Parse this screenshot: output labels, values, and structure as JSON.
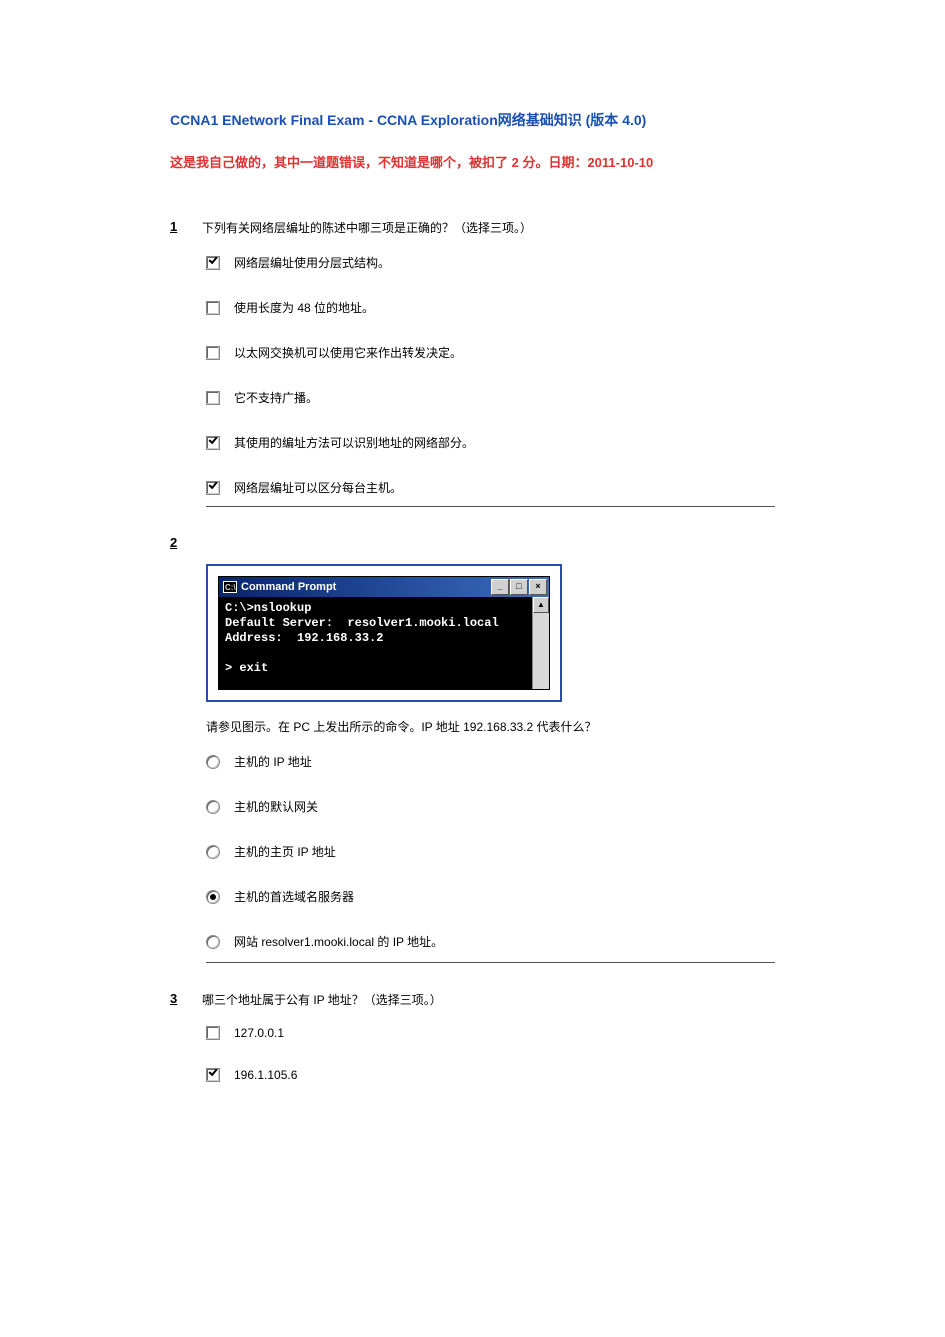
{
  "header": {
    "title": "CCNA1 ENetwork Final Exam - CCNA Exploration网络基础知识 (版本 4.0)",
    "subtitle": "这是我自己做的，其中一道题错误，不知道是哪个，被扣了 2 分。日期：2011-10-10"
  },
  "q1": {
    "num": "1",
    "text": "下列有关网络层编址的陈述中哪三项是正确的？（选择三项。）",
    "options": [
      {
        "label": "网络层编址使用分层式结构。",
        "checked": true
      },
      {
        "label": "使用长度为 48 位的地址。",
        "checked": false
      },
      {
        "label": "以太网交换机可以使用它来作出转发决定。",
        "checked": false
      },
      {
        "label": "它不支持广播。",
        "checked": false
      },
      {
        "label": "其使用的编址方法可以识别地址的网络部分。",
        "checked": true
      },
      {
        "label": "网络层编址可以区分每台主机。",
        "checked": true
      }
    ]
  },
  "q2": {
    "num": "2",
    "cmd": {
      "title": "Command Prompt",
      "iconText": "C:\\",
      "body": "C:\\>nslookup\nDefault Server:  resolver1.mooki.local\nAddress:  192.168.33.2\n\n> exit"
    },
    "caption": "请参见图示。在 PC 上发出所示的命令。IP 地址 192.168.33.2 代表什么？",
    "options": [
      {
        "label": "主机的 IP 地址",
        "checked": false
      },
      {
        "label": "主机的默认网关",
        "checked": false
      },
      {
        "label": "主机的主页 IP 地址",
        "checked": false
      },
      {
        "label": "主机的首选域名服务器",
        "checked": true
      },
      {
        "label": "网站 resolver1.mooki.local 的 IP 地址。",
        "checked": false
      }
    ]
  },
  "q3": {
    "num": "3",
    "text": "哪三个地址属于公有 IP 地址？（选择三项。）",
    "options": [
      {
        "label": "127.0.0.1",
        "checked": false
      },
      {
        "label": "196.1.105.6",
        "checked": true
      }
    ]
  }
}
